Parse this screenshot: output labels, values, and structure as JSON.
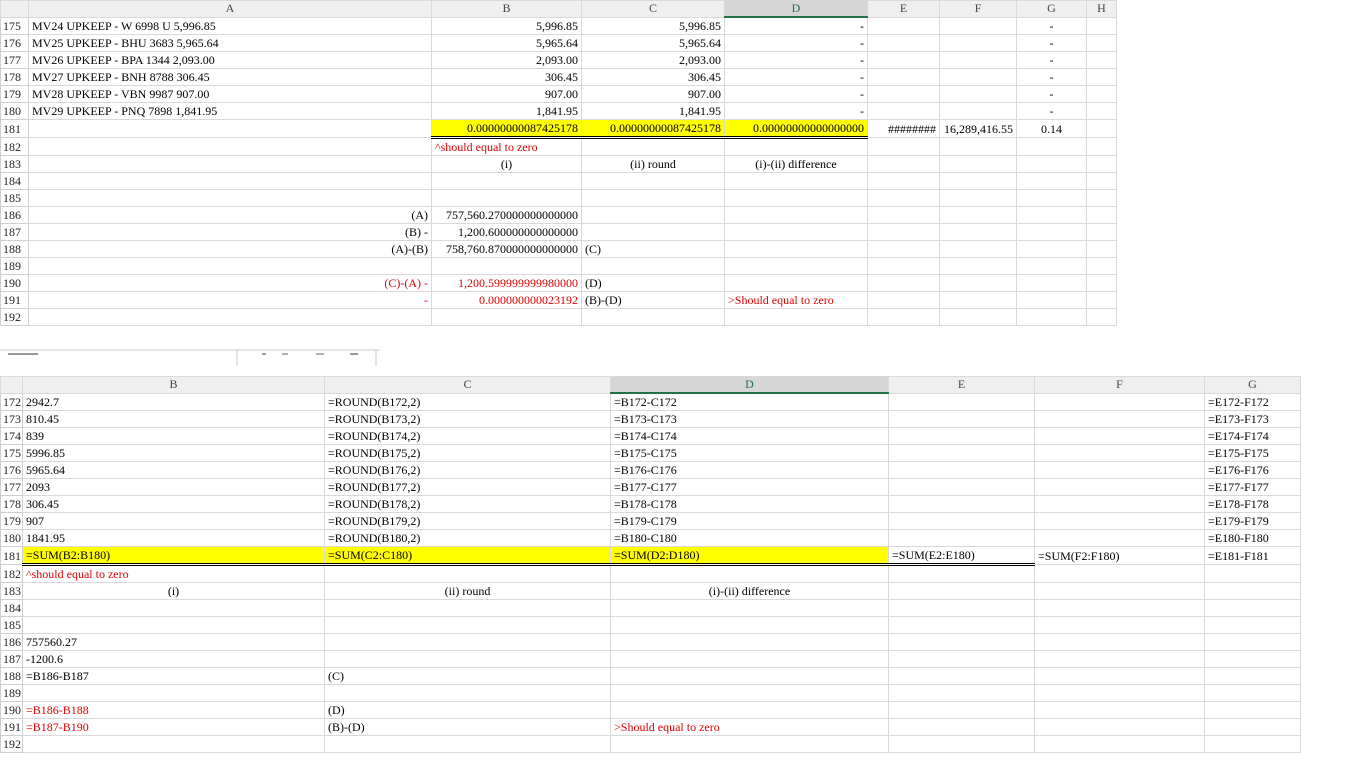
{
  "top": {
    "columns": [
      "",
      "A",
      "B",
      "C",
      "D",
      "E",
      "F",
      "G",
      "H"
    ],
    "rows": [
      {
        "n": "175",
        "a": "MV24 UPKEEP - W 6998 U 5,996.85",
        "b": "5,996.85",
        "c": "5,996.85",
        "d": "-",
        "e": "",
        "f": "",
        "g": "-"
      },
      {
        "n": "176",
        "a": "MV25 UPKEEP - BHU 3683 5,965.64",
        "b": "5,965.64",
        "c": "5,965.64",
        "d": "-",
        "e": "",
        "f": "",
        "g": "-"
      },
      {
        "n": "177",
        "a": "MV26 UPKEEP - BPA 1344 2,093.00",
        "b": "2,093.00",
        "c": "2,093.00",
        "d": "-",
        "e": "",
        "f": "",
        "g": "-"
      },
      {
        "n": "178",
        "a": "MV27 UPKEEP - BNH 8788 306.45",
        "b": "306.45",
        "c": "306.45",
        "d": "-",
        "e": "",
        "f": "",
        "g": "-"
      },
      {
        "n": "179",
        "a": "MV28 UPKEEP - VBN 9987 907.00",
        "b": "907.00",
        "c": "907.00",
        "d": "-",
        "e": "",
        "f": "",
        "g": "-"
      },
      {
        "n": "180",
        "a": "MV29 UPKEEP - PNQ 7898 1,841.95",
        "b": "1,841.95",
        "c": "1,841.95",
        "d": "-",
        "e": "",
        "f": "",
        "g": "-"
      },
      {
        "n": "181",
        "a": "",
        "b": "0.00000000087425178",
        "c": "0.00000000087425178",
        "d": "0.00000000000000000",
        "e": "########",
        "f": "16,289,416.55",
        "g": "0.14"
      },
      {
        "n": "182",
        "a": "",
        "b": "^should equal to zero",
        "c": "",
        "d": "",
        "e": "",
        "f": "",
        "g": ""
      },
      {
        "n": "183",
        "a": "",
        "b": "(i)",
        "c": "(ii) round",
        "d": "(i)-(ii) difference",
        "e": "",
        "f": "",
        "g": ""
      },
      {
        "n": "184",
        "a": "",
        "b": "",
        "c": "",
        "d": "",
        "e": "",
        "f": "",
        "g": ""
      },
      {
        "n": "185",
        "a": "",
        "b": "",
        "c": "",
        "d": "",
        "e": "",
        "f": "",
        "g": ""
      },
      {
        "n": "186",
        "a": "(A)",
        "b": "757,560.270000000000000",
        "c": "",
        "d": "",
        "e": "",
        "f": "",
        "g": ""
      },
      {
        "n": "187",
        "a": "(B) -",
        "b": "1,200.600000000000000",
        "c": "",
        "d": "",
        "e": "",
        "f": "",
        "g": ""
      },
      {
        "n": "188",
        "a": "(A)-(B)",
        "b": "758,760.870000000000000",
        "c": "(C)",
        "d": "",
        "e": "",
        "f": "",
        "g": ""
      },
      {
        "n": "189",
        "a": "",
        "b": "",
        "c": "",
        "d": "",
        "e": "",
        "f": "",
        "g": ""
      },
      {
        "n": "190",
        "a": "(C)-(A) -",
        "b": "1,200.599999999980000",
        "c": "(D)",
        "d": "",
        "e": "",
        "f": "",
        "g": ""
      },
      {
        "n": "191",
        "a": "-",
        "b": "0.000000000023192",
        "c": "(B)-(D)",
        "d": ">Should equal to zero",
        "e": "",
        "f": "",
        "g": ""
      },
      {
        "n": "192",
        "a": "",
        "b": "",
        "c": "",
        "d": "",
        "e": "",
        "f": "",
        "g": ""
      }
    ]
  },
  "bottom": {
    "columns": [
      "",
      "B",
      "C",
      "D",
      "E",
      "F",
      "G"
    ],
    "rows": [
      {
        "n": "172",
        "b": "2942.7",
        "c": "=ROUND(B172,2)",
        "d": "=B172-C172",
        "e": "",
        "f": "",
        "g": "=E172-F172"
      },
      {
        "n": "173",
        "b": "810.45",
        "c": "=ROUND(B173,2)",
        "d": "=B173-C173",
        "e": "",
        "f": "",
        "g": "=E173-F173"
      },
      {
        "n": "174",
        "b": "839",
        "c": "=ROUND(B174,2)",
        "d": "=B174-C174",
        "e": "",
        "f": "",
        "g": "=E174-F174"
      },
      {
        "n": "175",
        "b": "5996.85",
        "c": "=ROUND(B175,2)",
        "d": "=B175-C175",
        "e": "",
        "f": "",
        "g": "=E175-F175"
      },
      {
        "n": "176",
        "b": "5965.64",
        "c": "=ROUND(B176,2)",
        "d": "=B176-C176",
        "e": "",
        "f": "",
        "g": "=E176-F176"
      },
      {
        "n": "177",
        "b": "2093",
        "c": "=ROUND(B177,2)",
        "d": "=B177-C177",
        "e": "",
        "f": "",
        "g": "=E177-F177"
      },
      {
        "n": "178",
        "b": "306.45",
        "c": "=ROUND(B178,2)",
        "d": "=B178-C178",
        "e": "",
        "f": "",
        "g": "=E178-F178"
      },
      {
        "n": "179",
        "b": "907",
        "c": "=ROUND(B179,2)",
        "d": "=B179-C179",
        "e": "",
        "f": "",
        "g": "=E179-F179"
      },
      {
        "n": "180",
        "b": "1841.95",
        "c": "=ROUND(B180,2)",
        "d": "=B180-C180",
        "e": "",
        "f": "",
        "g": "=E180-F180"
      },
      {
        "n": "181",
        "b": "=SUM(B2:B180)",
        "c": "=SUM(C2:C180)",
        "d": "=SUM(D2:D180)",
        "e": "=SUM(E2:E180)",
        "f": "=SUM(F2:F180)",
        "g": "=E181-F181"
      },
      {
        "n": "182",
        "b": "^should equal to zero",
        "c": "",
        "d": "",
        "e": "",
        "f": "",
        "g": ""
      },
      {
        "n": "183",
        "b": "(i)",
        "c": "(ii) round",
        "d": "(i)-(ii) difference",
        "e": "",
        "f": "",
        "g": ""
      },
      {
        "n": "184",
        "b": "",
        "c": "",
        "d": "",
        "e": "",
        "f": "",
        "g": ""
      },
      {
        "n": "185",
        "b": "",
        "c": "",
        "d": "",
        "e": "",
        "f": "",
        "g": ""
      },
      {
        "n": "186",
        "b": "757560.27",
        "c": "",
        "d": "",
        "e": "",
        "f": "",
        "g": ""
      },
      {
        "n": "187",
        "b": "-1200.6",
        "c": "",
        "d": "",
        "e": "",
        "f": "",
        "g": ""
      },
      {
        "n": "188",
        "b": "=B186-B187",
        "c": "(C)",
        "d": "",
        "e": "",
        "f": "",
        "g": ""
      },
      {
        "n": "189",
        "b": "",
        "c": "",
        "d": "",
        "e": "",
        "f": "",
        "g": ""
      },
      {
        "n": "190",
        "b": "=B186-B188",
        "c": "(D)",
        "d": "",
        "e": "",
        "f": "",
        "g": ""
      },
      {
        "n": "191",
        "b": "=B187-B190",
        "c": "(B)-(D)",
        "d": ">Should equal to zero",
        "e": "",
        "f": "",
        "g": ""
      },
      {
        "n": "192",
        "b": "",
        "c": "",
        "d": "",
        "e": "",
        "f": "",
        "g": ""
      }
    ]
  },
  "colors": {
    "highlight": "#ffff00",
    "red_text": "#e00000",
    "grid": "#d9d9d9",
    "header": "#efefef"
  }
}
